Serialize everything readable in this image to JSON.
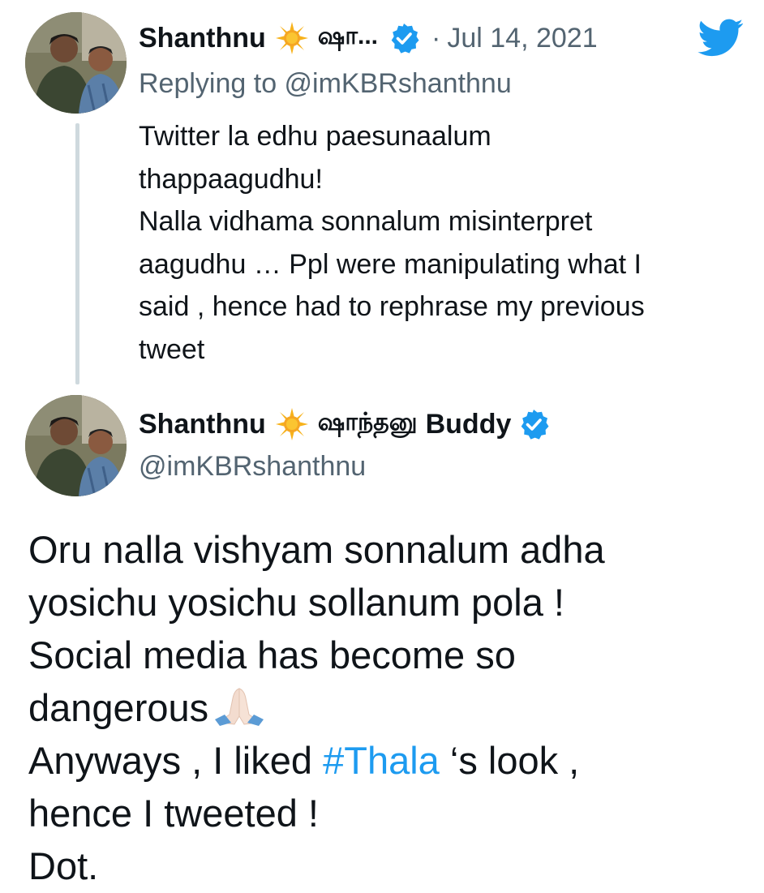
{
  "reply_tweet": {
    "author_name": "Shanthnu",
    "author_name_tamil_truncated": "ஷா...",
    "date": "Jul 14, 2021",
    "separator": "·",
    "replying_to_text": "Replying to @imKBRshanthnu",
    "text_lines": [
      "Twitter la edhu paesunaalum",
      "thappaagudhu!",
      "Nalla vidhama sonnalum misinterpret",
      "aagudhu … Ppl were manipulating what I",
      "said , hence had to rephrase my previous",
      "tweet"
    ]
  },
  "main_tweet": {
    "author_name": "Shanthnu",
    "author_name_tamil": "ஷாந்தனு",
    "author_name_suffix": "Buddy",
    "handle": "@imKBRshanthnu",
    "line1": "Oru nalla vishyam sonnalum adha",
    "line2": "yosichu yosichu sollanum pola !",
    "line3": "Social media has become so",
    "line4": "dangerous",
    "line5_before": "Anyways , I liked ",
    "hashtag": "#Thala",
    "line5_after": " ‘s look ,",
    "line6": "hence I tweeted !",
    "line7": "Dot."
  },
  "icons": {
    "sun": "sun-emoji-icon",
    "verified": "verified-badge-icon",
    "twitter": "twitter-bird-icon",
    "pray": "folded-hands-emoji-icon"
  },
  "colors": {
    "accent": "#1d9bf0",
    "muted": "#536471",
    "text": "#0f1419",
    "thread_line": "#cfd9de"
  }
}
